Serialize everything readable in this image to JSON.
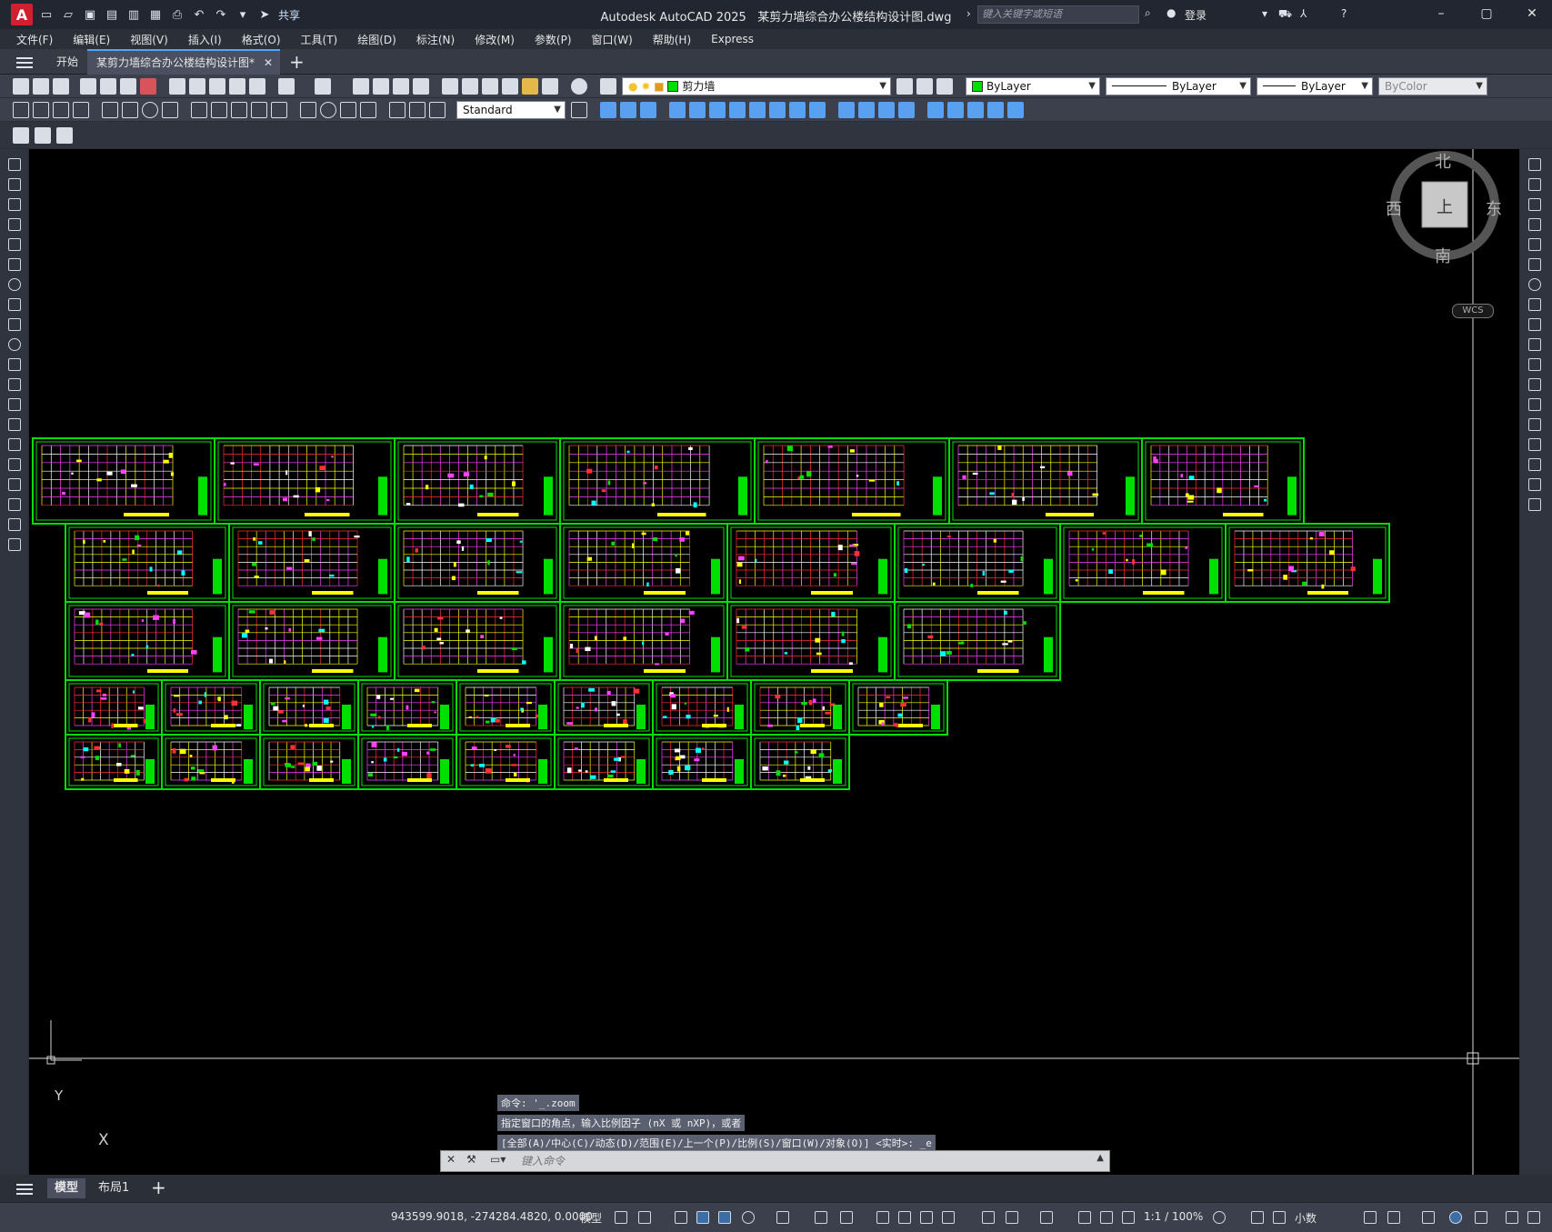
{
  "titlebar": {
    "app_name": "Autodesk AutoCAD 2025",
    "document": "某剪力墙综合办公楼结构设计图.dwg",
    "share_label": "共享",
    "search_placeholder": "键入关键字或短语",
    "login_label": "登录"
  },
  "menu": [
    "文件(F)",
    "编辑(E)",
    "视图(V)",
    "插入(I)",
    "格式(O)",
    "工具(T)",
    "绘图(D)",
    "标注(N)",
    "修改(M)",
    "参数(P)",
    "窗口(W)",
    "帮助(H)",
    "Express"
  ],
  "tabs": {
    "start": "开始",
    "document": "某剪力墙综合办公楼结构设计图*"
  },
  "toolbar": {
    "layer_name": "剪力墙",
    "color": "ByLayer",
    "linetype": "ByLayer",
    "lineweight": "ByLayer",
    "plotstyle": "ByColor",
    "text_style": "Standard"
  },
  "viewcube": {
    "north": "北",
    "south": "南",
    "east": "东",
    "west": "西",
    "face": "上",
    "wcs": "WCS"
  },
  "command": {
    "history": [
      "命令: '_.zoom",
      "指定窗口的角点，输入比例因子 (nX 或 nXP)，或者",
      "[全部(A)/中心(C)/动态(D)/范围(E)/上一个(P)/比例(S)/窗口(W)/对象(O)] <实时>: _e"
    ],
    "placeholder": "键入命令"
  },
  "ucs": {
    "x": "X",
    "y": "Y"
  },
  "layout_tabs": {
    "model": "模型",
    "layout1": "布局1"
  },
  "status": {
    "coordinates": "943599.9018, -274284.4820, 0.0000",
    "mode": "模型",
    "annotation_scale": "1:1 / 100%",
    "units": "小数"
  },
  "colors": {
    "frame": "#00e000",
    "canvas": "#000000",
    "accent": "#59a0ff"
  }
}
